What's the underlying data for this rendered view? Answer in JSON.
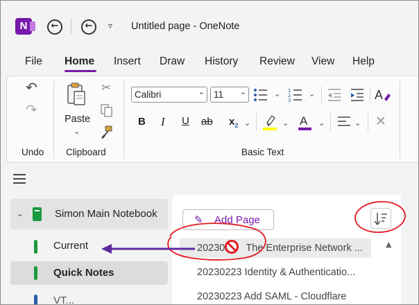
{
  "titlebar": {
    "app_logo_letter": "N",
    "title": "Untitled page  -  OneNote",
    "back_icon": "back-arrow-icon",
    "quick_access_dropdown": "▿"
  },
  "menu": {
    "items": [
      "File",
      "Home",
      "Insert",
      "Draw",
      "History",
      "Review",
      "View",
      "Help"
    ],
    "active": "Home",
    "accent_color": "#7719aa"
  },
  "ribbon": {
    "groups": {
      "undo": "Undo",
      "clipboard": "Clipboard",
      "basic_text": "Basic Text"
    },
    "paste_label": "Paste",
    "font_name": "Calibri",
    "font_size": "11",
    "format_buttons": [
      "B",
      "I",
      "U",
      "ab",
      "x"
    ],
    "subscript_mark": "2",
    "highlight_color": "#ffff00",
    "font_color": "#7719aa"
  },
  "navigation": {
    "notebook": "Simon Main Notebook",
    "sections": [
      "Current",
      "Quick Notes"
    ],
    "partial_section": "VT...",
    "section_color": "#1a9a3f"
  },
  "pages": {
    "add_page_label": "Add Page",
    "items": [
      "202302",
      "The Enterprise Network ...",
      "20230223 Identity & Authenticatio...",
      "20230223 Add SAML - Cloudflare"
    ]
  },
  "annotations": {
    "color": "#e21b23",
    "arrow_color": "#5b2a9e"
  }
}
